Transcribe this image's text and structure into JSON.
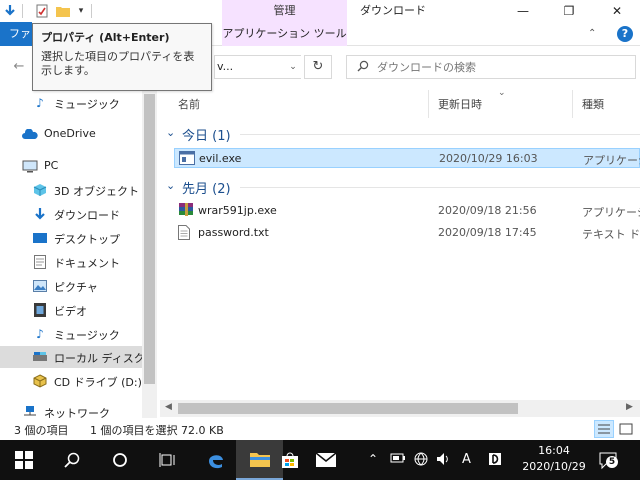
{
  "titlebar": {
    "context_group": "管理",
    "window_title": "ダウンロード",
    "minimize": "—",
    "maximize": "❐",
    "close": "✕"
  },
  "ribbon": {
    "file_tab": "ファイル",
    "app_tools_tab": "アプリケーション ツール",
    "collapse": "⌃",
    "help": "?"
  },
  "tooltip": {
    "title": "プロパティ (Alt+Enter)",
    "description": "選択した項目のプロパティを表示します。"
  },
  "address": {
    "path": "…» …",
    "visible_text": "v...",
    "refresh": "↻"
  },
  "search": {
    "placeholder": "ダウンロードの検索"
  },
  "nav": {
    "items": [
      {
        "label": "ミュージック",
        "icon": "music-icon"
      },
      {
        "label": "OneDrive",
        "icon": "cloud-icon"
      },
      {
        "label": "PC",
        "icon": "pc-icon"
      },
      {
        "label": "3D オブジェクト",
        "icon": "3d-objects-icon"
      },
      {
        "label": "ダウンロード",
        "icon": "download-icon"
      },
      {
        "label": "デスクトップ",
        "icon": "desktop-icon"
      },
      {
        "label": "ドキュメント",
        "icon": "documents-icon"
      },
      {
        "label": "ピクチャ",
        "icon": "pictures-icon"
      },
      {
        "label": "ビデオ",
        "icon": "video-icon"
      },
      {
        "label": "ミュージック",
        "icon": "music-icon"
      },
      {
        "label": "ローカル ディスク (C",
        "icon": "drive-icon"
      },
      {
        "label": "CD ドライブ (D:) Vi",
        "icon": "cd-drive-icon"
      },
      {
        "label": "ネットワーク",
        "icon": "network-icon"
      }
    ]
  },
  "columns": {
    "name": "名前",
    "modified": "更新日時",
    "type": "種類"
  },
  "groups": [
    {
      "label": "今日 (1)",
      "files": [
        {
          "name": "evil.exe",
          "date": "2020/10/29 16:03",
          "type": "アプリケーション",
          "icon": "exe-icon",
          "selected": true
        }
      ]
    },
    {
      "label": "先月 (2)",
      "files": [
        {
          "name": "wrar591jp.exe",
          "date": "2020/09/18 21:56",
          "type": "アプリケーション",
          "icon": "winrar-icon",
          "selected": false
        },
        {
          "name": "password.txt",
          "date": "2020/09/18 17:45",
          "type": "テキスト ドキュメント",
          "icon": "text-file-icon",
          "selected": false
        }
      ]
    }
  ],
  "status": {
    "item_count": "3 個の項目",
    "selection": "1 個の項目を選択  72.0 KB"
  },
  "taskbar": {
    "time": "16:04",
    "date": "2020/10/29",
    "ime": "A",
    "notifications": "5"
  },
  "colors": {
    "accent": "#1a73c9",
    "context_tab": "#f6e2ff",
    "selection_bg": "#cce8ff",
    "selection_border": "#99d1ff",
    "group_header": "#1c4f8e",
    "taskbar": "#101010"
  }
}
